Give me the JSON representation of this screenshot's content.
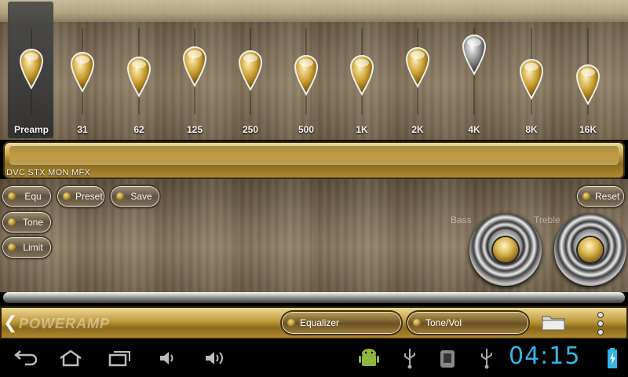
{
  "equalizer": {
    "bands": [
      {
        "label": "Preamp",
        "level": 0.5
      },
      {
        "label": "31",
        "level": 0.46
      },
      {
        "label": "62",
        "level": 0.4
      },
      {
        "label": "125",
        "level": 0.53
      },
      {
        "label": "250",
        "level": 0.48
      },
      {
        "label": "500",
        "level": 0.42
      },
      {
        "label": "1K",
        "level": 0.42
      },
      {
        "label": "2K",
        "level": 0.52
      },
      {
        "label": "4K",
        "level": 0.68
      },
      {
        "label": "8K",
        "level": 0.37
      },
      {
        "label": "16K",
        "level": 0.3
      }
    ]
  },
  "mode_label": "DVC STX MON MFX",
  "buttons": {
    "equ": "Equ",
    "preset": "Preset",
    "save": "Save",
    "reset": "Reset",
    "tone": "Tone",
    "limit": "Limit"
  },
  "knobs": {
    "bass_label": "Bass",
    "treble_label": "Treble"
  },
  "bottom_bar": {
    "logo": "POWERAMP",
    "tab_equalizer": "Equalizer",
    "tab_tonevol": "Tone/Vol"
  },
  "status": {
    "time": "04:15"
  },
  "icons": {
    "back": "back-arrow-icon",
    "home": "home-icon",
    "recents": "recent-apps-icon",
    "vol_down": "volume-down-icon",
    "vol_up": "volume-up-icon",
    "android": "android-icon",
    "usb": "usb-icon",
    "debug": "usb-debugging-icon",
    "battery": "battery-charging-icon"
  },
  "colors": {
    "accent_blue": "#33b5e5",
    "gold": "#c9a447"
  }
}
